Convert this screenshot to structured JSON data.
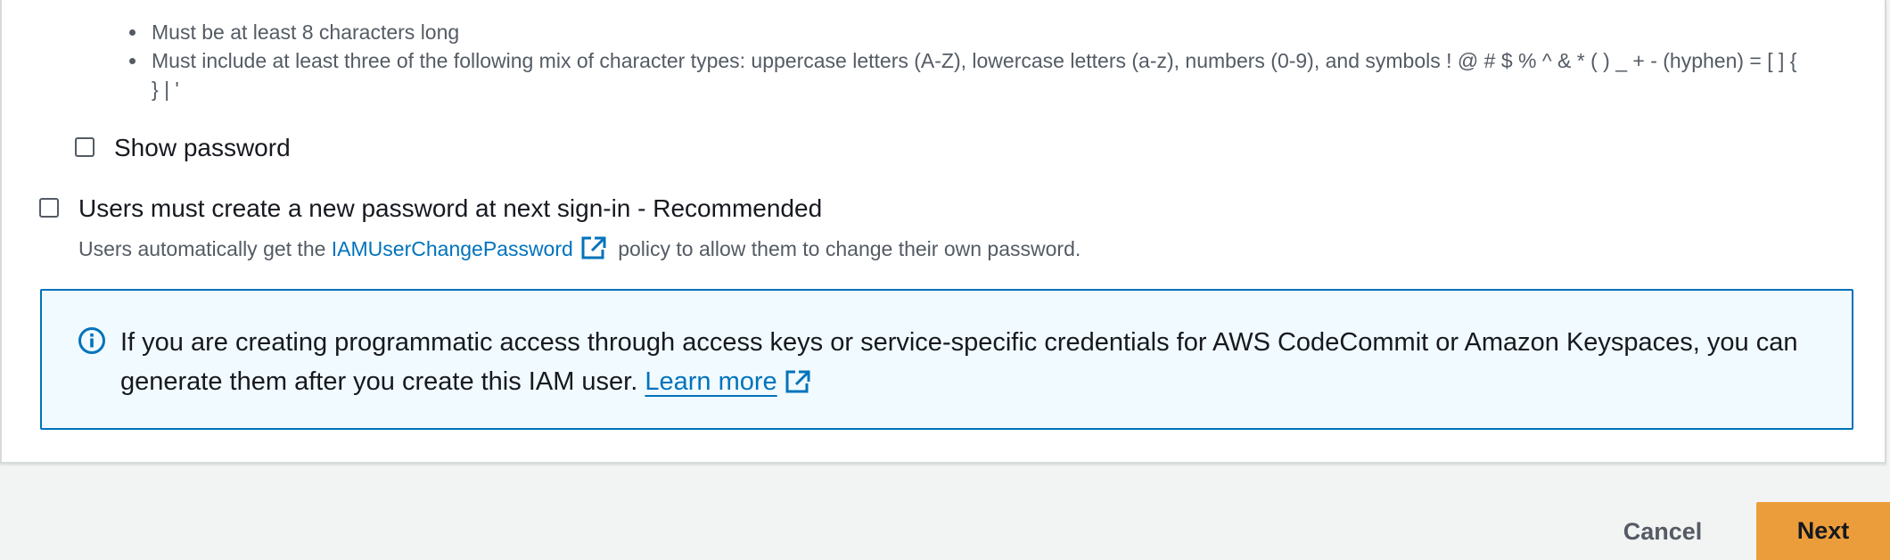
{
  "password_rules": [
    "Must be at least 8 characters long",
    "Must include at least three of the following mix of character types: uppercase letters (A-Z), lowercase letters (a-z), numbers (0-9), and symbols ! @ # $ % ^ & * ( ) _ + - (hyphen) = [ ] { } | '"
  ],
  "show_password": {
    "label": "Show password",
    "checked": false
  },
  "reset_required": {
    "label": "Users must create a new password at next sign-in - Recommended",
    "checked": false,
    "description_prefix": "Users automatically get the",
    "policy_link": "IAMUserChangePassword",
    "description_suffix": "policy to allow them to change their own password."
  },
  "info_alert": {
    "icon": "info-icon",
    "text": "If you are creating programmatic access through access keys or service-specific credentials for AWS CodeCommit or Amazon Keyspaces, you can generate them after you create this IAM user.",
    "link_label": "Learn more"
  },
  "footer": {
    "cancel_label": "Cancel",
    "next_label": "Next"
  },
  "colors": {
    "link": "#0073bb",
    "primary_button": "#ec9d3b",
    "info_background": "#f1faff",
    "info_border": "#0073bb",
    "page_background": "#f2f3f3"
  }
}
